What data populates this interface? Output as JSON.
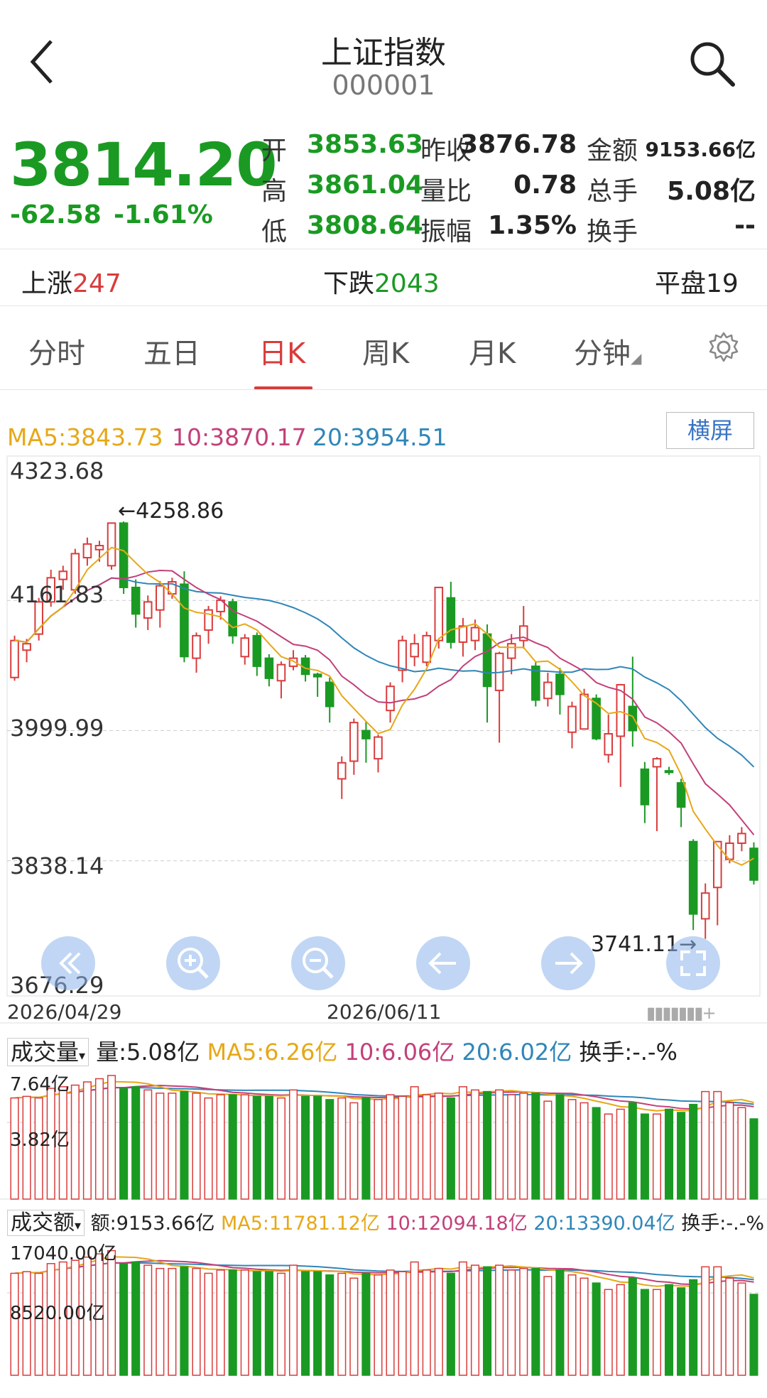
{
  "header": {
    "title": "上证指数",
    "code": "000001"
  },
  "quote": {
    "price": "3814.20",
    "change": "-62.58",
    "change_pct": "-1.61%",
    "stats": [
      {
        "label": "开",
        "value": "3853.63",
        "color": "green"
      },
      {
        "label": "昨收",
        "value": "3876.78",
        "color": "black"
      },
      {
        "label": "金额",
        "value": "9153.66亿",
        "color": "black"
      },
      {
        "label": "高",
        "value": "3861.04",
        "color": "green"
      },
      {
        "label": "量比",
        "value": "0.78",
        "color": "black"
      },
      {
        "label": "总手",
        "value": "5.08亿",
        "color": "black"
      },
      {
        "label": "低",
        "value": "3808.64",
        "color": "green"
      },
      {
        "label": "振幅",
        "value": "1.35%",
        "color": "black"
      },
      {
        "label": "换手",
        "value": "--",
        "color": "black"
      }
    ]
  },
  "breadth": {
    "up_label": "上涨",
    "up_value": "247",
    "down_label": "下跌",
    "down_value": "2043",
    "flat_label": "平盘",
    "flat_value": "19"
  },
  "tabs": [
    {
      "label": "分时",
      "active": false
    },
    {
      "label": "五日",
      "active": false
    },
    {
      "label": "日K",
      "active": true
    },
    {
      "label": "周K",
      "active": false
    },
    {
      "label": "月K",
      "active": false
    },
    {
      "label": "分钟",
      "active": false
    }
  ],
  "kline": {
    "ma_legend": {
      "ma5": "MA5:3843.73",
      "ma10": "10:3870.17",
      "ma20": "20:3954.51"
    },
    "landscape_button": "横屏",
    "y_labels": [
      "4323.68",
      "4161.83",
      "3999.99",
      "3838.14",
      "3676.29"
    ],
    "high_marker": "4258.86",
    "low_marker": "3741.11",
    "x_labels": [
      "2026/04/29",
      "2026/06/11"
    ],
    "colors": {
      "up": "#d93c3c",
      "down": "#1a9a23",
      "ma5": "#e6a817",
      "ma10": "#c2407a",
      "ma20": "#2f86b8"
    }
  },
  "volume": {
    "menu_label": "成交量",
    "value": "量:5.08亿",
    "ma5": "MA5:6.26亿",
    "ma10": "10:6.06亿",
    "ma20": "20:6.02亿",
    "turnover": "换手:-.-%",
    "y_labels": [
      "7.64亿",
      "3.82亿"
    ]
  },
  "amount": {
    "menu_label": "成交额",
    "value": "额:9153.66亿",
    "ma5": "MA5:11781.12亿",
    "ma10": "10:12094.18亿",
    "ma20": "20:13390.04亿",
    "turnover": "换手:-.-%",
    "y_labels": [
      "17040.00亿",
      "8520.00亿"
    ]
  },
  "chart_data": {
    "type": "candlestick",
    "x_range": [
      "2026/04/29",
      "2026/06/11"
    ],
    "ylim": [
      3676.29,
      4323.68
    ],
    "candles": [
      [
        4066,
        4112,
        4062,
        4118
      ],
      [
        4100,
        4108,
        4085,
        4114
      ],
      [
        4120,
        4160,
        4112,
        4165
      ],
      [
        4160,
        4190,
        4154,
        4200
      ],
      [
        4188,
        4198,
        4175,
        4205
      ],
      [
        4175,
        4220,
        4170,
        4226
      ],
      [
        4215,
        4232,
        4205,
        4240
      ],
      [
        4225,
        4230,
        4210,
        4236
      ],
      [
        4205,
        4258,
        4200,
        4258.86
      ],
      [
        4258,
        4178,
        4170,
        4260
      ],
      [
        4178,
        4145,
        4128,
        4188
      ],
      [
        4140,
        4160,
        4125,
        4168
      ],
      [
        4150,
        4180,
        4128,
        4186
      ],
      [
        4170,
        4185,
        4164,
        4190
      ],
      [
        4182,
        4092,
        4085,
        4198
      ],
      [
        4090,
        4118,
        4072,
        4122
      ],
      [
        4125,
        4150,
        4108,
        4155
      ],
      [
        4148,
        4162,
        4138,
        4167
      ],
      [
        4160,
        4118,
        4108,
        4164
      ],
      [
        4092,
        4115,
        4082,
        4120
      ],
      [
        4118,
        4080,
        4068,
        4122
      ],
      [
        4090,
        4065,
        4055,
        4095
      ],
      [
        4062,
        4082,
        4040,
        4086
      ],
      [
        4080,
        4090,
        4075,
        4100
      ],
      [
        4090,
        4070,
        4061,
        4094
      ],
      [
        4070,
        4067,
        4042,
        4072
      ],
      [
        4060,
        4030,
        4010,
        4066
      ],
      [
        3940,
        3960,
        3915,
        3968
      ],
      [
        3962,
        4010,
        3945,
        4015
      ],
      [
        4000,
        3990,
        3960,
        4012
      ],
      [
        3965,
        3992,
        3948,
        3995
      ],
      [
        4025,
        4055,
        4010,
        4060
      ],
      [
        4075,
        4112,
        4060,
        4118
      ],
      [
        4092,
        4108,
        4080,
        4120
      ],
      [
        4085,
        4118,
        4080,
        4123
      ],
      [
        4112,
        4178,
        4102,
        4178
      ],
      [
        4165,
        4110,
        4102,
        4185
      ],
      [
        4110,
        4130,
        4092,
        4140
      ],
      [
        4112,
        4128,
        4100,
        4138
      ],
      [
        4120,
        4055,
        4010,
        4132
      ],
      [
        4050,
        4096,
        3985,
        4098
      ],
      [
        4090,
        4108,
        4070,
        4120
      ],
      [
        4112,
        4130,
        4102,
        4155
      ],
      [
        4080,
        4038,
        4030,
        4086
      ],
      [
        4040,
        4060,
        4030,
        4072
      ],
      [
        4070,
        4045,
        4020,
        4078
      ],
      [
        3998,
        4030,
        3978,
        4036
      ],
      [
        4002,
        4045,
        4008,
        4052
      ],
      [
        4040,
        3990,
        3988,
        4045
      ],
      [
        3970,
        3996,
        3960,
        4020
      ],
      [
        3993,
        4057,
        3930,
        4058
      ],
      [
        4030,
        4000,
        3980,
        4092
      ],
      [
        3952,
        3908,
        3885,
        3961
      ],
      [
        3955,
        3965,
        3875,
        3967
      ],
      [
        3950,
        3948,
        3945,
        3955
      ],
      [
        3935,
        3905,
        3880,
        3940
      ],
      [
        3862,
        3772,
        3752,
        3865
      ],
      [
        3766,
        3798,
        3741.11,
        3810
      ],
      [
        3805,
        3862,
        3758,
        3862
      ],
      [
        3840,
        3860,
        3835,
        3870
      ],
      [
        3860,
        3872,
        3850,
        3880
      ],
      [
        3853.63,
        3814.2,
        3808.64,
        3861.04
      ]
    ],
    "volume_yi": [
      6.3,
      6.4,
      6.3,
      6.9,
      7.0,
      7.1,
      7.3,
      7.5,
      7.7,
      6.9,
      7.0,
      6.8,
      6.6,
      6.6,
      6.7,
      6.6,
      6.3,
      6.5,
      6.5,
      6.5,
      6.4,
      6.4,
      6.3,
      6.8,
      6.4,
      6.4,
      6.2,
      6.3,
      6.0,
      6.3,
      6.2,
      6.5,
      6.4,
      7.0,
      6.5,
      6.6,
      6.3,
      7.0,
      6.8,
      6.7,
      6.8,
      6.5,
      6.6,
      6.6,
      6.1,
      6.5,
      6.2,
      6.0,
      5.7,
      5.3,
      5.6,
      6.0,
      5.3,
      5.3,
      5.6,
      5.4,
      5.9,
      6.7,
      6.7,
      6.0,
      5.7,
      5.0
    ]
  }
}
